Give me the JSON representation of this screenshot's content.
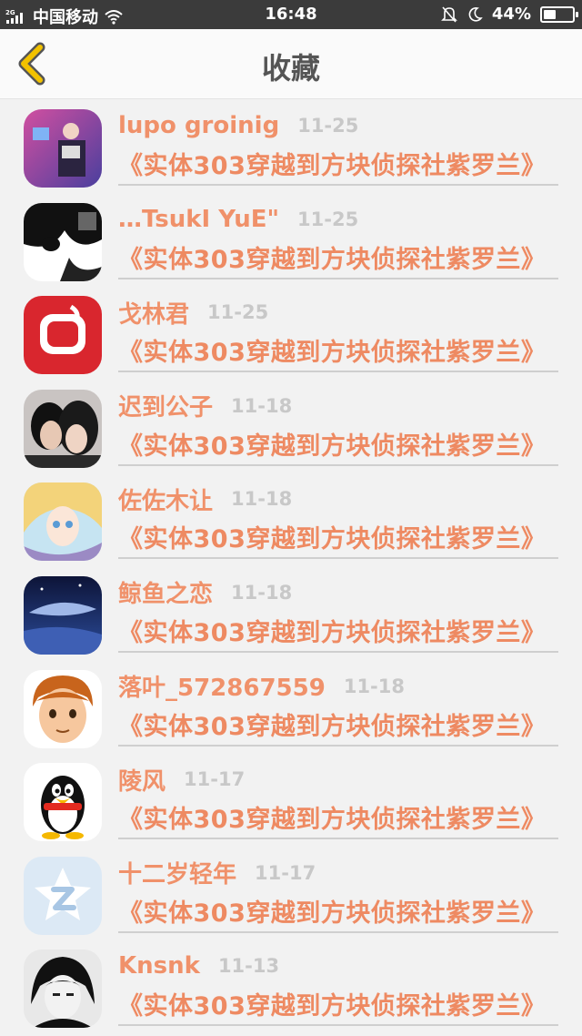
{
  "status_bar": {
    "network_label": "2G",
    "carrier": "中国移动",
    "time": "16:48",
    "battery_percent": "44%",
    "battery_level": 0.44
  },
  "nav": {
    "back_icon": "chevron-left-icon",
    "title": "收藏"
  },
  "colors": {
    "accent": "#f0916a",
    "back_arrow": "#f2c200"
  },
  "items": [
    {
      "username": "lupo groinig",
      "date": "11-25",
      "title": "《实体303穿越到方块侦探社紫罗兰》"
    },
    {
      "username": "…TsukI YuE\"",
      "date": "11-25",
      "title": "《实体303穿越到方块侦探社紫罗兰》"
    },
    {
      "username": "戈林君",
      "date": "11-25",
      "title": "《实体303穿越到方块侦探社紫罗兰》"
    },
    {
      "username": "迟到公子",
      "date": "11-18",
      "title": "《实体303穿越到方块侦探社紫罗兰》"
    },
    {
      "username": "佐佐木让",
      "date": "11-18",
      "title": "《实体303穿越到方块侦探社紫罗兰》"
    },
    {
      "username": "鲸鱼之恋",
      "date": "11-18",
      "title": "《实体303穿越到方块侦探社紫罗兰》"
    },
    {
      "username": "落叶_572867559",
      "date": "11-18",
      "title": "《实体303穿越到方块侦探社紫罗兰》"
    },
    {
      "username": "陵风",
      "date": "11-17",
      "title": "《实体303穿越到方块侦探社紫罗兰》"
    },
    {
      "username": "十二岁轻年",
      "date": "11-17",
      "title": "《实体303穿越到方块侦探社紫罗兰》"
    },
    {
      "username": "Knsnk",
      "date": "11-13",
      "title": "《实体303穿越到方块侦探社紫罗兰》"
    }
  ]
}
